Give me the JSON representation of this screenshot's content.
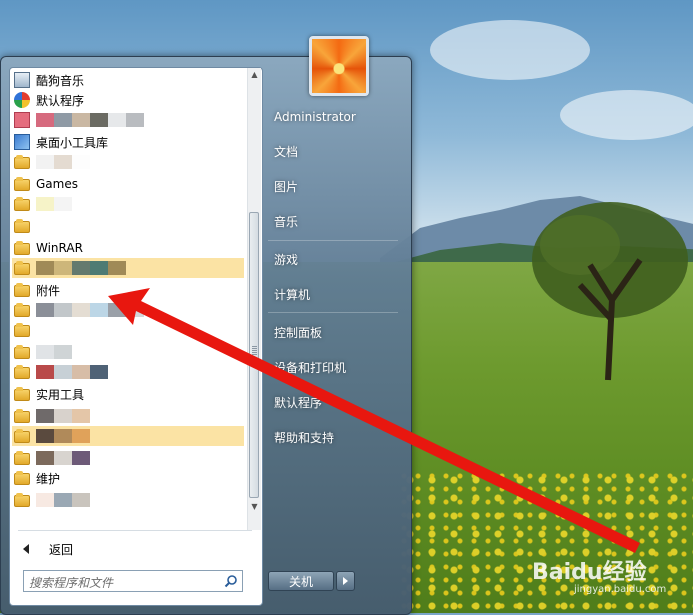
{
  "start_menu": {
    "programs": [
      {
        "label": "酷狗音乐",
        "icon": "kugou-music-icon",
        "hl": false
      },
      {
        "label": "默认程序",
        "icon": "default-programs-icon",
        "hl": false
      },
      {
        "label": "",
        "icon": "app-icon",
        "hl": false
      },
      {
        "label": "桌面小工具库",
        "icon": "gadgets-icon",
        "hl": false
      },
      {
        "label": "",
        "icon": "folder-icon",
        "hl": false
      },
      {
        "label": "Games",
        "icon": "folder-icon",
        "hl": false
      },
      {
        "label": "",
        "icon": "folder-icon",
        "hl": false
      },
      {
        "label": "",
        "icon": "folder-icon",
        "hl": false
      },
      {
        "label": "WinRAR",
        "icon": "folder-icon",
        "hl": false
      },
      {
        "label": "",
        "icon": "folder-icon",
        "hl": true
      },
      {
        "label": "附件",
        "icon": "folder-icon",
        "hl": false
      },
      {
        "label": "",
        "icon": "folder-icon",
        "hl": false
      },
      {
        "label": "",
        "icon": "folder-icon",
        "hl": false
      },
      {
        "label": "",
        "icon": "folder-icon",
        "hl": false
      },
      {
        "label": "",
        "icon": "folder-icon",
        "hl": false
      },
      {
        "label": "实用工具",
        "icon": "folder-icon",
        "hl": false
      },
      {
        "label": "",
        "icon": "folder-icon",
        "hl": false
      },
      {
        "label": "",
        "icon": "folder-icon",
        "hl": true
      },
      {
        "label": "",
        "icon": "folder-icon",
        "hl": false
      },
      {
        "label": "维护",
        "icon": "folder-icon",
        "hl": false
      },
      {
        "label": "",
        "icon": "folder-icon",
        "hl": false
      }
    ],
    "back_label": "返回",
    "search_placeholder": "搜索程序和文件",
    "user_name": "Administrator",
    "right_items": [
      "文档",
      "图片",
      "音乐",
      "游戏",
      "计算机",
      "控制面板",
      "设备和打印机",
      "默认程序",
      "帮助和支持"
    ],
    "shutdown_label": "关机"
  },
  "watermark": {
    "brand": "Baidu经验",
    "url": "jingyan.baidu.com"
  },
  "colors": {
    "highlight": "#fbe3a4",
    "arrow": "#e8170f"
  }
}
